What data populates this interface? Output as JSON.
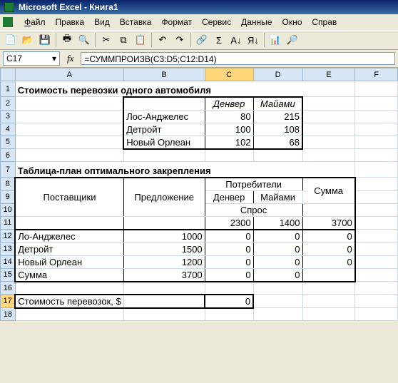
{
  "title": "Microsoft Excel - Книга1",
  "menu": {
    "file": "Файл",
    "edit": "Правка",
    "view": "Вид",
    "insert": "Вставка",
    "format": "Формат",
    "tools": "Сервис",
    "data": "Данные",
    "window": "Окно",
    "help": "Справ"
  },
  "namebox": "C17",
  "formula": "=СУММПРОИЗВ(C3:D5;C12:D14)",
  "cols": [
    "A",
    "B",
    "C",
    "D",
    "E",
    "F"
  ],
  "rows": [
    "1",
    "2",
    "3",
    "4",
    "5",
    "6",
    "7",
    "8",
    "9",
    "10",
    "11",
    "12",
    "13",
    "14",
    "15",
    "16",
    "17",
    "18"
  ],
  "heading1": "Стоимость перевозки одного автомобиля",
  "t1": {
    "h_denver": "Денвер",
    "h_miami": "Майами",
    "r1_city": "Лос-Анджелес",
    "r1_d": "80",
    "r1_m": "215",
    "r2_city": "Детройт",
    "r2_d": "100",
    "r2_m": "108",
    "r3_city": "Новый Орлеан",
    "r3_d": "102",
    "r3_m": "68"
  },
  "heading2": "Таблица-план оптимального закрепления",
  "t2": {
    "suppliers": "Поставщики",
    "offer": "Предложение",
    "consumers": "Потребители",
    "denver": "Денвер",
    "miami": "Майами",
    "demand": "Спрос",
    "sum": "Сумма",
    "dem_d": "2300",
    "dem_m": "1400",
    "dem_sum": "3700",
    "r1_city": "Ло-Анджелес",
    "r1_offer": "1000",
    "r1_d": "0",
    "r1_m": "0",
    "r1_s": "0",
    "r2_city": "Детройт",
    "r2_offer": "1500",
    "r2_d": "0",
    "r2_m": "0",
    "r2_s": "0",
    "r3_city": "Новый Орлеан",
    "r3_offer": "1200",
    "r3_d": "0",
    "r3_m": "0",
    "r3_s": "0",
    "r4_city": "Сумма",
    "r4_offer": "3700",
    "r4_d": "0",
    "r4_m": "0"
  },
  "cost_label": "Стоимость перевозок, $",
  "cost_value": "0",
  "chart_data": {
    "type": "table",
    "tables": [
      {
        "title": "Стоимость перевозки одного автомобиля",
        "columns": [
          "Денвер",
          "Майами"
        ],
        "rows": [
          "Лос-Анджелес",
          "Детройт",
          "Новый Орлеан"
        ],
        "values": [
          [
            80,
            215
          ],
          [
            100,
            108
          ],
          [
            102,
            68
          ]
        ]
      },
      {
        "title": "Таблица-план оптимального закрепления",
        "suppliers": [
          "Ло-Анджелес",
          "Детройт",
          "Новый Орлеан"
        ],
        "offer": [
          1000,
          1500,
          1200
        ],
        "consumers": [
          "Денвер",
          "Майами"
        ],
        "demand": [
          2300,
          1400
        ],
        "sum_offer": 3700,
        "sum_demand": 3700,
        "plan": [
          [
            0,
            0
          ],
          [
            0,
            0
          ],
          [
            0,
            0
          ]
        ],
        "row_sums": [
          0,
          0,
          0
        ],
        "col_sums": [
          0,
          0
        ]
      }
    ],
    "cost_of_transport": 0
  }
}
